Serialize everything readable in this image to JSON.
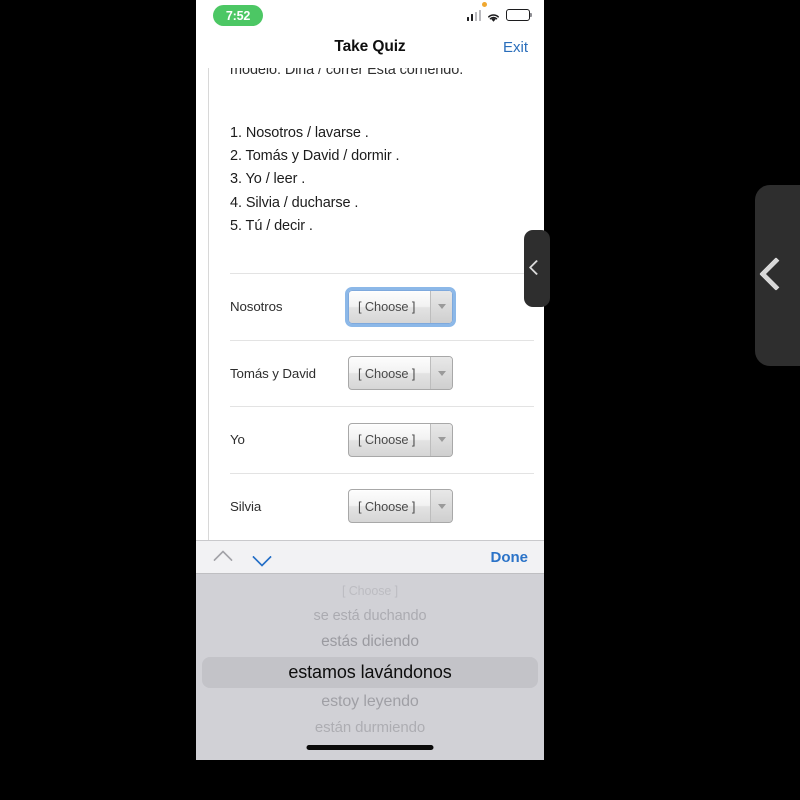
{
  "status_bar": {
    "time": "7:52",
    "time_pill_color": "#4cc764",
    "signal_icon": "cellular-signal-icon",
    "wifi_icon": "wifi-icon",
    "battery_icon": "battery-icon"
  },
  "nav_bar": {
    "title": "Take Quiz",
    "exit_label": "Exit",
    "link_color": "#2a6ebb"
  },
  "content": {
    "modelo_line": "modelo: Diria / correr Está corriendo.",
    "prompts": [
      "1. Nosotros / lavarse .",
      "2. Tomás y David / dormir .",
      "3. Yo / leer .",
      "4. Silvia / ducharse .",
      "5. Tú / decir ."
    ],
    "rows": [
      {
        "label": "Nosotros",
        "value": "[ Choose ]",
        "focused": true
      },
      {
        "label": "Tomás y David",
        "value": "[ Choose ]",
        "focused": false
      },
      {
        "label": "Yo",
        "value": "[ Choose ]",
        "focused": false
      },
      {
        "label": "Silvia",
        "value": "[ Choose ]",
        "focused": false
      }
    ]
  },
  "picker": {
    "toolbar": {
      "prev_icon": "chevron-up-icon",
      "next_icon": "chevron-down-icon",
      "done_label": "Done"
    },
    "options": [
      "[ Choose ]",
      "se está duchando",
      "estás diciendo",
      "estamos lavándonos",
      "estoy leyendo",
      "están durmiendo"
    ],
    "selected_index": 3,
    "selected_value": "estamos lavándonos",
    "background_color": "#d1d1d6"
  },
  "edge_tabs": {
    "small_icon": "chevron-left-back-icon",
    "large_icon": "chevron-left-back-icon"
  }
}
